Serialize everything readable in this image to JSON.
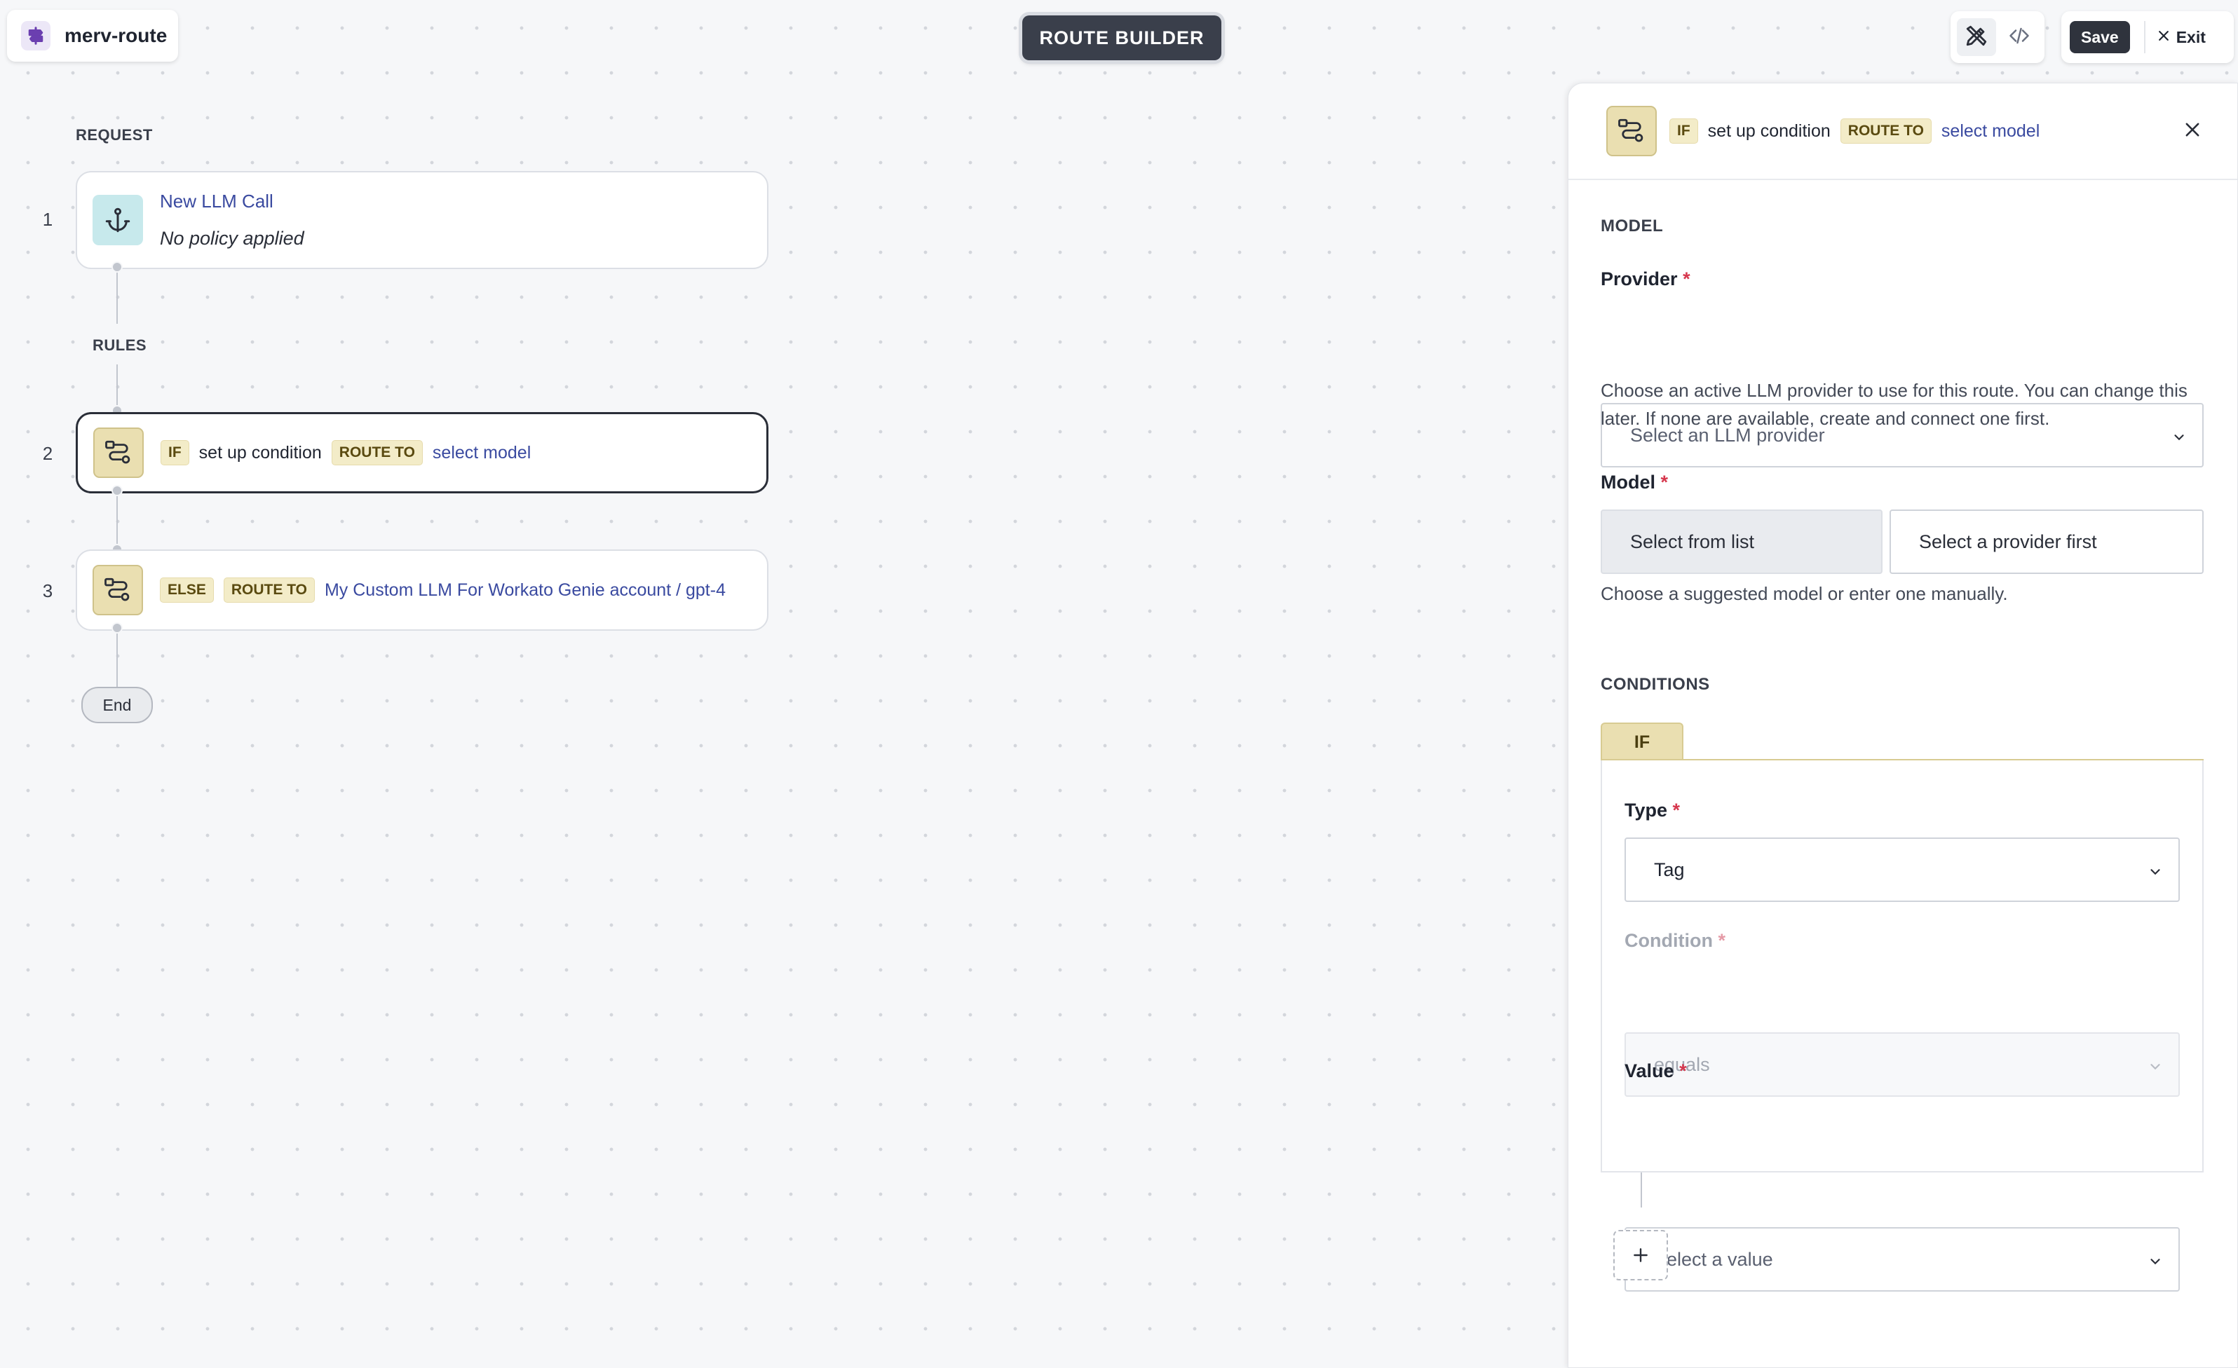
{
  "app": {
    "name": "merv-route"
  },
  "header": {
    "mode_title": "ROUTE BUILDER",
    "save_label": "Save",
    "exit_label": "Exit"
  },
  "flow": {
    "request_label": "REQUEST",
    "rules_label": "RULES",
    "end_label": "End",
    "steps": [
      {
        "num": "1",
        "title": "New LLM Call",
        "subtitle": "No policy applied"
      },
      {
        "num": "2",
        "if_tag": "IF",
        "condition": "set up condition",
        "route_tag": "ROUTE TO",
        "target": "select model"
      },
      {
        "num": "3",
        "else_tag": "ELSE",
        "route_tag": "ROUTE TO",
        "target": "My Custom LLM For Workato Genie account / gpt-4"
      }
    ]
  },
  "panel": {
    "header": {
      "if_tag": "IF",
      "condition": "set up condition",
      "route_tag": "ROUTE TO",
      "target": "select model"
    },
    "model_section": "MODEL",
    "provider": {
      "label": "Provider",
      "required": "*",
      "placeholder": "Select an LLM provider",
      "help": "Choose an active LLM provider to use for this route. You can change this later. If none are available, create and connect one first."
    },
    "model": {
      "label": "Model",
      "required": "*",
      "option_list": "Select from list",
      "option_other": "Select a provider first",
      "help": "Choose a suggested model or enter one manually."
    },
    "conditions_section": "CONDITIONS",
    "condition_tab": "IF",
    "type": {
      "label": "Type",
      "required": "*",
      "value": "Tag"
    },
    "condition": {
      "label": "Condition",
      "required": "*",
      "value": "equals"
    },
    "value": {
      "label": "Value",
      "required": "*",
      "placeholder": "Select a value"
    }
  },
  "icons": {
    "app": "signpost-icon",
    "builder": "pencil-ruler-icon",
    "code": "code-icon",
    "request": "anchor-icon",
    "route": "route-icon",
    "close": "close-icon",
    "add": "plus-icon"
  },
  "colors": {
    "accent_link": "#3a4aa0",
    "tag_bg": "#f3ecc8",
    "required": "#d6374d",
    "dark_button": "#2f333d"
  }
}
